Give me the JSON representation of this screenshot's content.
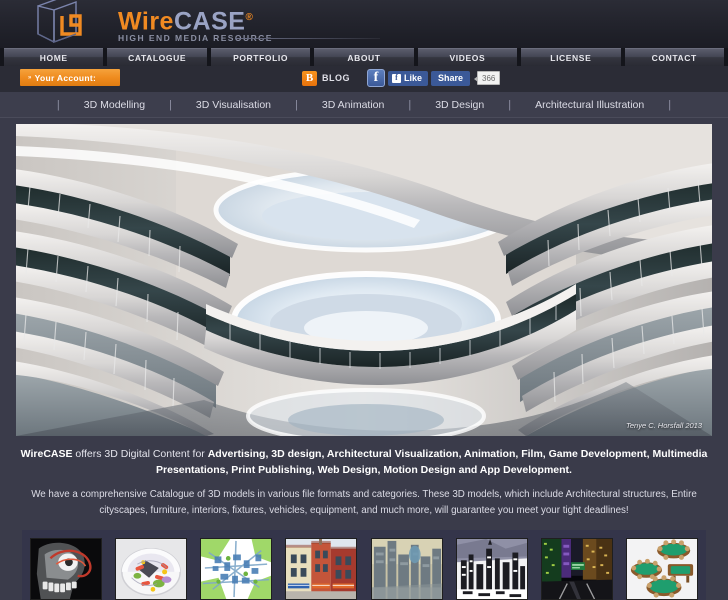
{
  "brand": {
    "name_part1": "Wire",
    "name_part2": "CASE",
    "registered": "®",
    "tagline": "HIGH END MEDIA RESOURCE",
    "logo_icon": "wireframe-cube-logo"
  },
  "main_nav": {
    "items": [
      {
        "label": "HOME"
      },
      {
        "label": "CATALOGUE"
      },
      {
        "label": "PORTFOLIO"
      },
      {
        "label": "ABOUT"
      },
      {
        "label": "VIDEOS"
      },
      {
        "label": "LICENSE"
      },
      {
        "label": "CONTACT"
      }
    ]
  },
  "utility_bar": {
    "account_label": "Your Account:",
    "account_arrow": "»",
    "blog_label": "BLOG",
    "blog_icon": "blogger-icon",
    "facebook": {
      "logo_icon": "facebook-icon",
      "logo_glyph": "f",
      "like_label": "Like",
      "like_icon": "facebook-thumb-icon",
      "share_label": "Share",
      "share_count": "366"
    }
  },
  "sub_nav": {
    "separator": "|",
    "items": [
      {
        "label": "3D Modelling"
      },
      {
        "label": "3D Visualisation"
      },
      {
        "label": "3D Animation"
      },
      {
        "label": "3D Design"
      },
      {
        "label": "Architectural Illustration"
      }
    ]
  },
  "hero": {
    "alt": "futuristic curved atrium interior with tiered balconies and oval skylights",
    "credit": "Tenye C. Horsfall 2013"
  },
  "intro": {
    "lead_prefix": "WireCASE",
    "lead_mid": " offers 3D Digital Content for ",
    "lead_strong": "Advertising, 3D design, Architectural Visualization, Animation, Film, Game Development, Multimedia Presentations, Print Publishing, Web Design, Motion Design and App Development.",
    "body": "We have a comprehensive Catalogue of 3D models in various file formats and categories. These 3D models, which include Architectural structures, Entire cityscapes, furniture, interiors, fixtures, vehicles, equipment, and much more, will guarantee you meet your tight deadlines!"
  },
  "thumbnails": {
    "items": [
      {
        "name": "anatomical-skull-xray",
        "alt": "medical anatomy skull x-ray render"
      },
      {
        "name": "biological-cell-cutaway",
        "alt": "biological cell cutaway model"
      },
      {
        "name": "city-map-diagram",
        "alt": "abstract blue green city map diagram"
      },
      {
        "name": "european-townhouses",
        "alt": "red and cream european townhouse facades"
      },
      {
        "name": "scifi-cityscape",
        "alt": "sci-fi cityscape with towers"
      },
      {
        "name": "monochrome-city",
        "alt": "black and white stylised city model"
      },
      {
        "name": "night-city-street",
        "alt": "night city street with neon signs"
      },
      {
        "name": "poker-tables",
        "alt": "green poker tables with chairs"
      }
    ]
  },
  "colors": {
    "page_background": "#3a3b4a",
    "header_background": "#23242d",
    "accent_orange": "#ef8c1f",
    "brand_blue": "#9aa3c4",
    "facebook_blue": "#3b5998",
    "subnav_background": "#3d3e4d",
    "thumb_panel_background": "#34354a"
  }
}
